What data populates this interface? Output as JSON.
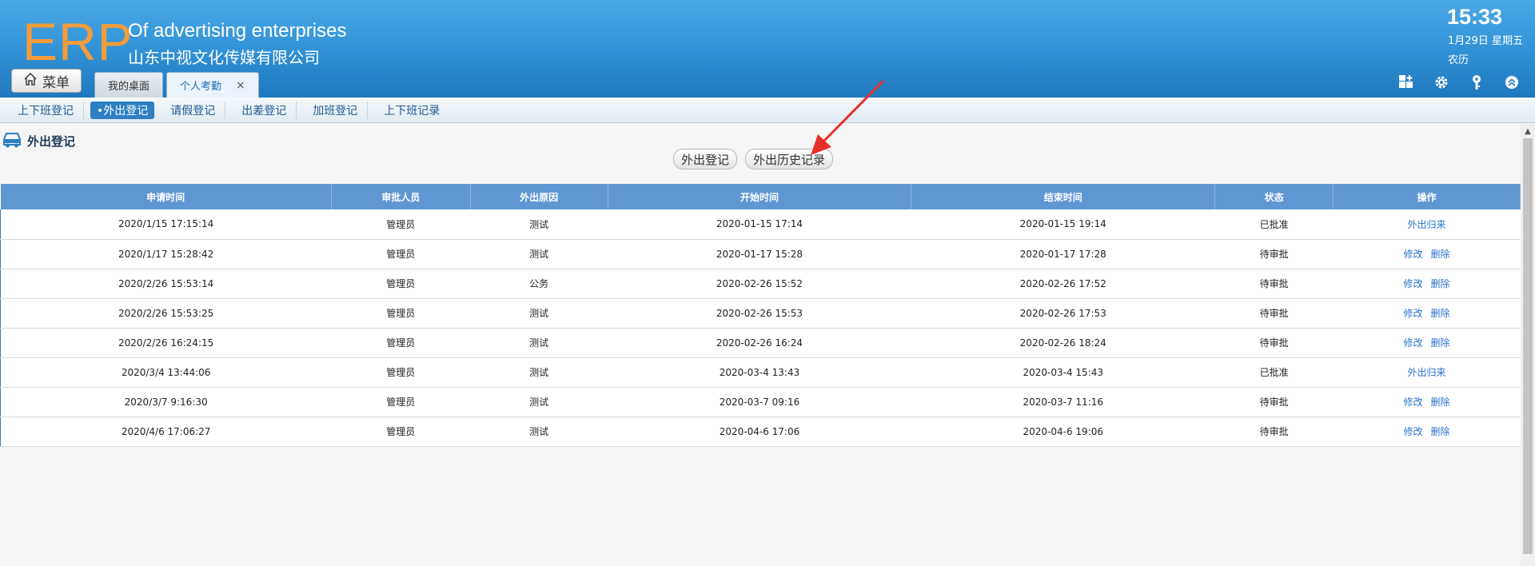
{
  "header": {
    "logo": "ERP",
    "company_en": "Of advertising enterprises",
    "company_cn": "山东中视文化传媒有限公司",
    "time": "15:33",
    "date": "1月29日 星期五",
    "lunar": "农历",
    "menu_label": "菜单",
    "icons": [
      "grid-add-icon",
      "gear-icon",
      "key-icon",
      "collapse-up-icon"
    ]
  },
  "tabs": [
    {
      "label": "我的桌面",
      "active": false
    },
    {
      "label": "个人考勤",
      "active": true,
      "closable": true,
      "close": "×"
    }
  ],
  "subnav": [
    {
      "label": "上下班登记"
    },
    {
      "label": "•外出登记",
      "active": true
    },
    {
      "label": "请假登记"
    },
    {
      "label": "出差登记"
    },
    {
      "label": "加班登记"
    },
    {
      "label": "上下班记录"
    }
  ],
  "main": {
    "title": "外出登记",
    "buttons": [
      "外出登记",
      "外出历史记录"
    ],
    "columns": [
      "申请时间",
      "审批人员",
      "外出原因",
      "开始时间",
      "结束时间",
      "状态",
      "操作"
    ],
    "rows": [
      {
        "apply": "2020/1/15 17:15:14",
        "approver": "管理员",
        "reason": "测试",
        "start": "2020-01-15 17:14",
        "end": "2020-01-15 19:14",
        "status": "已批准",
        "approved": true,
        "ops": [
          "外出归来"
        ]
      },
      {
        "apply": "2020/1/17 15:28:42",
        "approver": "管理员",
        "reason": "测试",
        "start": "2020-01-17 15:28",
        "end": "2020-01-17 17:28",
        "status": "待审批",
        "approved": false,
        "ops": [
          "修改",
          "删除"
        ]
      },
      {
        "apply": "2020/2/26 15:53:14",
        "approver": "管理员",
        "reason": "公务",
        "start": "2020-02-26 15:52",
        "end": "2020-02-26 17:52",
        "status": "待审批",
        "approved": false,
        "ops": [
          "修改",
          "删除"
        ]
      },
      {
        "apply": "2020/2/26 15:53:25",
        "approver": "管理员",
        "reason": "测试",
        "start": "2020-02-26 15:53",
        "end": "2020-02-26 17:53",
        "status": "待审批",
        "approved": false,
        "ops": [
          "修改",
          "删除"
        ]
      },
      {
        "apply": "2020/2/26 16:24:15",
        "approver": "管理员",
        "reason": "测试",
        "start": "2020-02-26 16:24",
        "end": "2020-02-26 18:24",
        "status": "待审批",
        "approved": false,
        "ops": [
          "修改",
          "删除"
        ]
      },
      {
        "apply": "2020/3/4 13:44:06",
        "approver": "管理员",
        "reason": "测试",
        "start": "2020-03-4 13:43",
        "end": "2020-03-4 15:43",
        "status": "已批准",
        "approved": true,
        "ops": [
          "外出归来"
        ]
      },
      {
        "apply": "2020/3/7 9:16:30",
        "approver": "管理员",
        "reason": "测试",
        "start": "2020-03-7 09:16",
        "end": "2020-03-7 11:16",
        "status": "待审批",
        "approved": false,
        "ops": [
          "修改",
          "删除"
        ]
      },
      {
        "apply": "2020/4/6 17:06:27",
        "approver": "管理员",
        "reason": "测试",
        "start": "2020-04-6 17:06",
        "end": "2020-04-6 19:06",
        "status": "待审批",
        "approved": false,
        "ops": [
          "修改",
          "删除"
        ]
      }
    ]
  },
  "colors": {
    "header_blue": "#3595d8",
    "logo_orange": "#f39c3c",
    "table_header": "#5f97d3",
    "approved_green": "#1aa31a",
    "link_blue": "#2a72c9",
    "arrow_red": "#e8302a"
  }
}
